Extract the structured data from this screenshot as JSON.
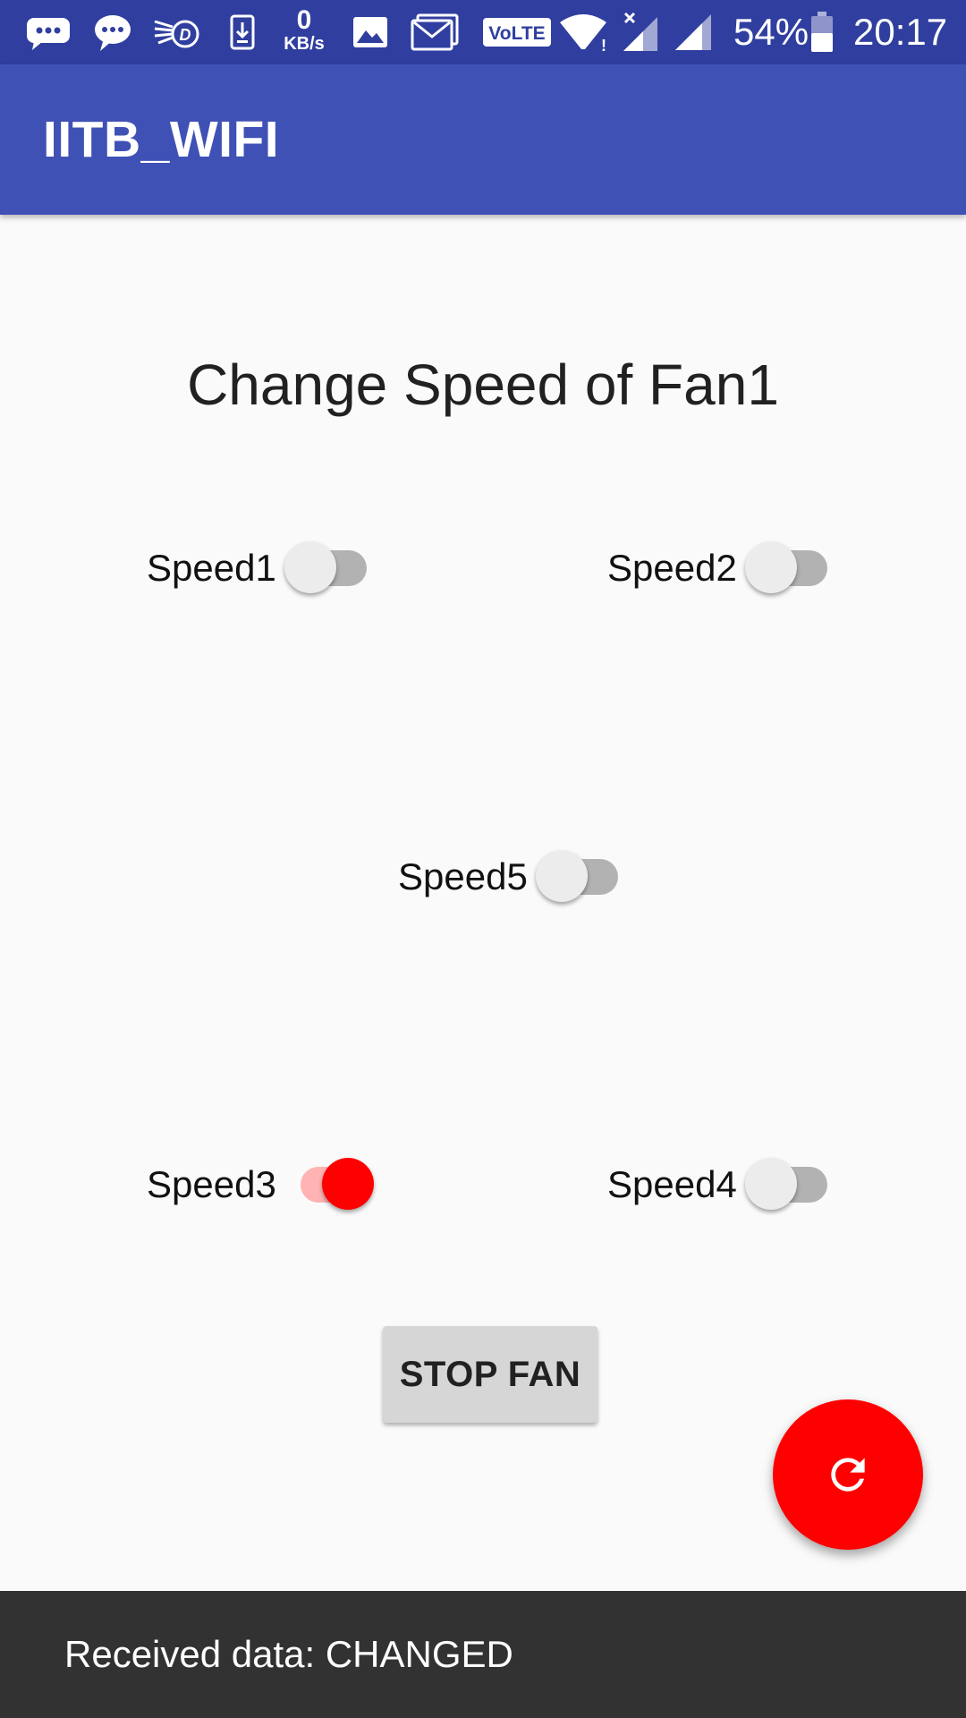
{
  "status_bar": {
    "data_rate_value": "0",
    "data_rate_unit": "KB/s",
    "volte": "VoLTE",
    "battery": "54%",
    "time": "20:17"
  },
  "app_bar": {
    "title": "IITB_WIFI"
  },
  "main": {
    "heading": "Change Speed of Fan1",
    "switches": [
      {
        "label": "Speed1",
        "on": false
      },
      {
        "label": "Speed2",
        "on": false
      },
      {
        "label": "Speed5",
        "on": false
      },
      {
        "label": "Speed3",
        "on": true
      },
      {
        "label": "Speed4",
        "on": false
      }
    ],
    "stop_button_label": "STOP FAN"
  },
  "fab": {
    "icon": "refresh-icon"
  },
  "snackbar": {
    "message": "Received data: CHANGED"
  },
  "colors": {
    "status_bar": "#303F9F",
    "app_bar": "#3F51B5",
    "accent": "#FF0000",
    "snackbar": "#323232"
  }
}
